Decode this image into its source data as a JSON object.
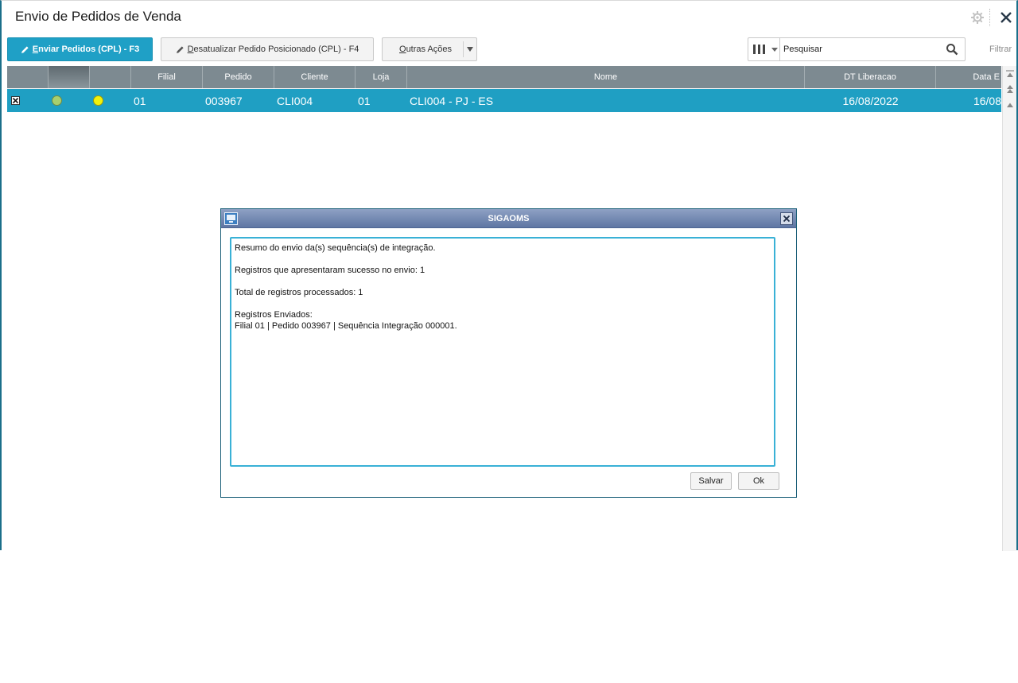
{
  "window": {
    "title": "Envio de Pedidos de Venda"
  },
  "toolbar": {
    "enviar_label": "Enviar Pedidos (CPL) - F3",
    "desatualizar_label": "Desatualizar Pedido Posicionado (CPL) - F4",
    "outras_label": "Outras Ações"
  },
  "search": {
    "value": "Pesquisar"
  },
  "filter_label": "Filtrar",
  "grid": {
    "columns": [
      "Filial",
      "Pedido",
      "Cliente",
      "Loja",
      "Nome",
      "DT Liberacao",
      "Data E"
    ],
    "rows": [
      {
        "status_colors": [
          "#a8cf6e",
          "#f2f20a"
        ],
        "filial": "01",
        "pedido": "003967",
        "cliente": "CLI004",
        "loja": "01",
        "nome": "CLI004 - PJ - ES",
        "dt_liberacao": "16/08/2022",
        "data_e": "16/08"
      }
    ]
  },
  "dialog": {
    "title": "SIGAOMS",
    "lines": [
      "Resumo do envio da(s) sequência(s) de integração.",
      "",
      "Registros que apresentaram sucesso no envio: 1",
      "",
      "Total de registros processados: 1",
      "",
      "Registros Enviados:",
      "Filial 01 | Pedido 003967 | Sequência Integração 000001."
    ],
    "save_label": "Salvar",
    "ok_label": "Ok"
  },
  "colors": {
    "accent": "#1fa0c6",
    "selected_row": "#1f9fc3",
    "grid_header": "#7d8a91",
    "dialog_titlebar": "#6c82ae"
  }
}
